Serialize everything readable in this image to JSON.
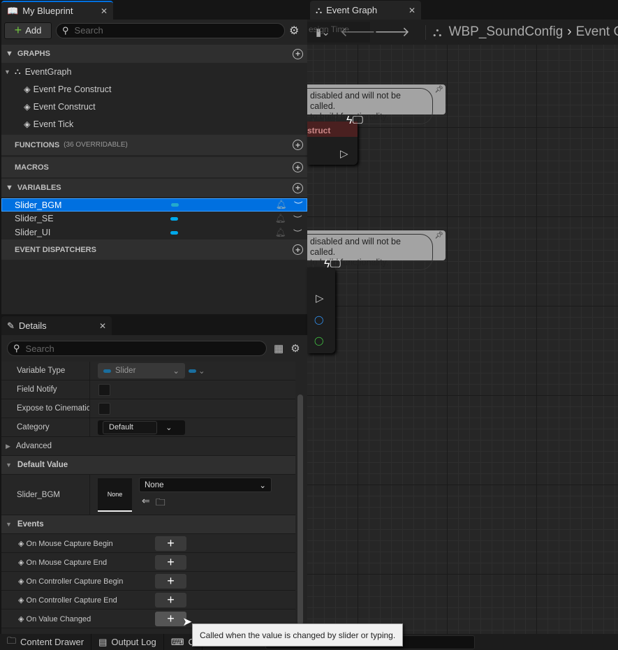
{
  "my_blueprint": {
    "tab_title": "My Blueprint",
    "add_label": "Add",
    "search_placeholder": "Search",
    "sections": {
      "graphs": "GRAPHS",
      "functions": "FUNCTIONS",
      "functions_note": "(36 OVERRIDABLE)",
      "macros": "MACROS",
      "variables": "VARIABLES",
      "dispatchers": "EVENT DISPATCHERS"
    },
    "graphs": {
      "event_graph": "EventGraph",
      "events": [
        "Event Pre Construct",
        "Event Construct",
        "Event Tick"
      ]
    },
    "variables": [
      "Slider_BGM",
      "Slider_SE",
      "Slider_UI"
    ],
    "selected_variable": "Slider_BGM"
  },
  "graph": {
    "tab_title": "Event Graph",
    "breadcrumb": [
      "WBP_SoundConfig",
      "Event Gra"
    ],
    "design_time_label": "esign Time",
    "comment1": [
      "disabled and will not be called.",
      "to build functionality."
    ],
    "comment2": [
      "disabled and will not be called.",
      "to build functionality."
    ],
    "node1_title": "struct"
  },
  "details": {
    "tab_title": "Details",
    "search_placeholder": "Search",
    "variable_type_label": "Variable Type",
    "variable_type_value": "Slider",
    "field_notify_label": "Field Notify",
    "expose_label": "Expose to Cinematic",
    "category_label": "Category",
    "category_value": "Default",
    "advanced_label": "Advanced",
    "default_value_header": "Default Value",
    "default_var_label": "Slider_BGM",
    "thumbnail_text": "None",
    "asset_value": "None",
    "events_header": "Events",
    "events": [
      "On Mouse Capture Begin",
      "On Mouse Capture End",
      "On Controller Capture Begin",
      "On Controller Capture End",
      "On Value Changed"
    ]
  },
  "tooltip": "Called when the value is changed by slider or typing.",
  "bottom_bar": {
    "content_drawer": "Content Drawer",
    "output_log": "Output Log",
    "cmd": "C"
  },
  "colors": {
    "accent": "#0070e0",
    "variable_pill": "#00a8ea",
    "add_plus": "#70c040"
  }
}
